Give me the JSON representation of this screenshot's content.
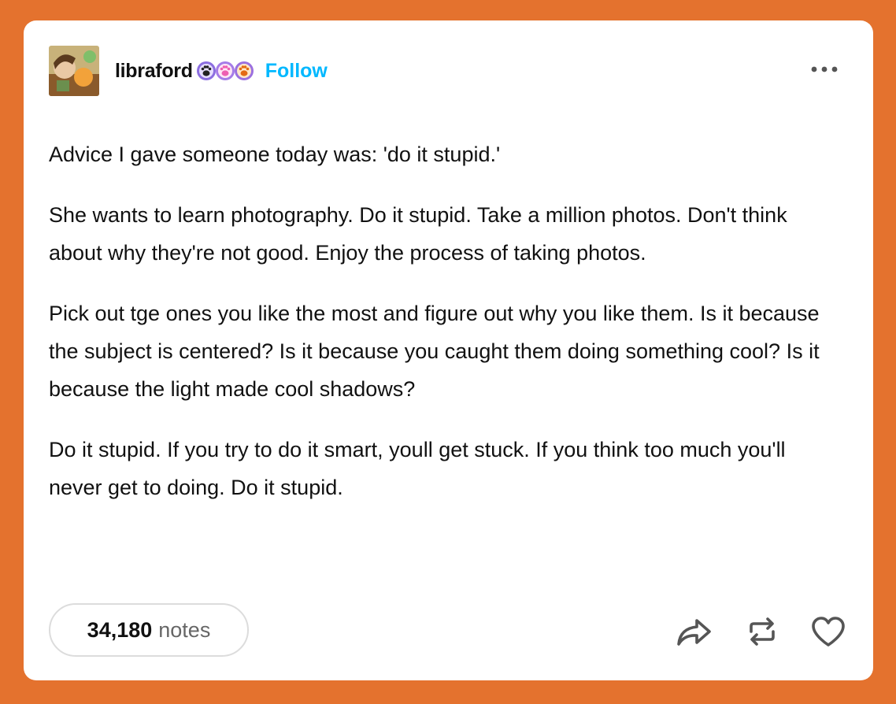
{
  "post": {
    "username": "libraford",
    "follow_label": "Follow",
    "badges": [
      "paw-badge-dark",
      "paw-badge-pink",
      "paw-badge-orange"
    ],
    "paragraphs": [
      "Advice I gave someone today was: 'do it stupid.'",
      "She wants to learn photography. Do it stupid. Take a million photos. Don't think about why they're not good. Enjoy the process of taking photos.",
      "Pick out tge ones you like the most and figure out why you like them. Is it because the subject is centered? Is it because you caught them doing something cool? Is it because the light made cool shadows?",
      "Do it stupid. If you try to do it smart, youll get stuck. If you think too much you'll never get to doing. Do it stupid."
    ],
    "notes_count": "34,180",
    "notes_label": "notes"
  },
  "colors": {
    "background": "#e4722e",
    "card": "#ffffff",
    "follow": "#00b8ff",
    "text": "#111111"
  },
  "icons": {
    "more": "more-options-icon",
    "share": "share-icon",
    "reblog": "reblog-icon",
    "like": "heart-icon"
  }
}
